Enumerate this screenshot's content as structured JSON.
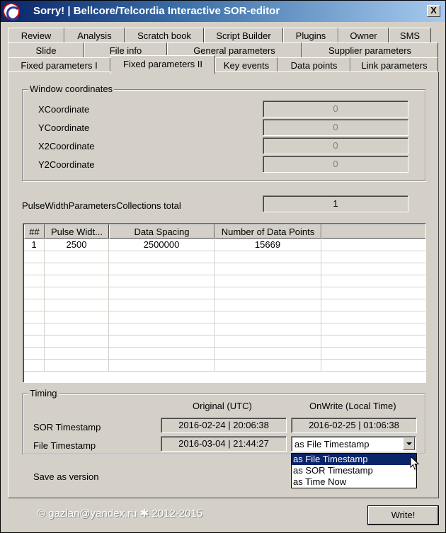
{
  "window": {
    "title": "Sorry!  |  Bellcore/Telcordia Interactive SOR-editor",
    "close_label": "X"
  },
  "tabs": {
    "row1": [
      "Review",
      "Analysis",
      "Scratch book",
      "Script Builder",
      "Plugins",
      "Owner",
      "SMS"
    ],
    "row2": [
      "Slide",
      "File info",
      "General parameters",
      "Supplier parameters"
    ],
    "row3": [
      "Fixed parameters I",
      "Fixed parameters II",
      "Key events",
      "Data points",
      "Link parameters"
    ],
    "active": "Fixed parameters II"
  },
  "window_coordinates": {
    "group_label": "Window coordinates",
    "fields": [
      {
        "label": "XCoordinate",
        "value": "0"
      },
      {
        "label": "YCoordinate",
        "value": "0"
      },
      {
        "label": "X2Coordinate",
        "value": "0"
      },
      {
        "label": "Y2Coordinate",
        "value": "0"
      }
    ]
  },
  "pulse": {
    "total_label": "PulseWidthParametersCollections total",
    "total_value": "1"
  },
  "grid": {
    "columns": [
      "##",
      "Pulse Widt...",
      "Data Spacing",
      "Number of Data Points",
      ""
    ],
    "rows": [
      [
        "1",
        "2500",
        "2500000",
        "15669",
        ""
      ]
    ]
  },
  "timing": {
    "group_label": "Timing",
    "col_original": "Original (UTC)",
    "col_onwrite": "OnWrite (Local Time)",
    "sor_label": "SOR Timestamp",
    "sor_original": "2016-02-24  |  20:06:38",
    "sor_onwrite": "2016-02-25  |  01:06:38",
    "file_label": "File Timestamp",
    "file_original": "2016-03-04  |  21:44:27",
    "file_select_value": "as File Timestamp",
    "options": [
      "as File Timestamp",
      "as SOR Timestamp",
      "as Time Now"
    ],
    "save_label": "Save as version"
  },
  "footer": {
    "copyright": "©  gazlan@yandex.ru  ✱  2012-2015",
    "write_label": "Write!"
  }
}
